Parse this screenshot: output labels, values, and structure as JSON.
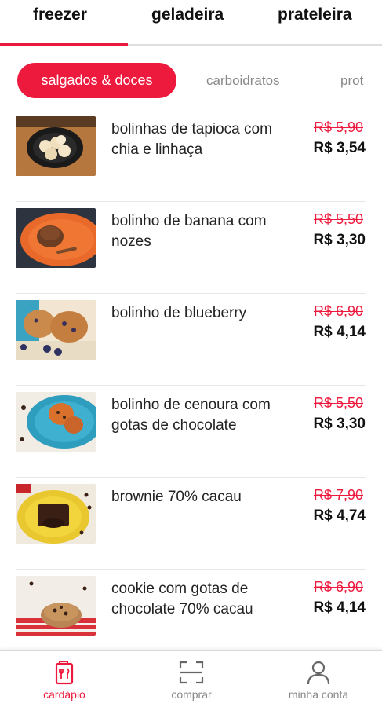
{
  "top_tabs": [
    {
      "label": "freezer",
      "active": true
    },
    {
      "label": "geladeira",
      "active": false
    },
    {
      "label": "prateleira",
      "active": false
    }
  ],
  "sub_tabs": [
    {
      "label": "salgados & doces",
      "active": true
    },
    {
      "label": "carboidratos",
      "active": false
    },
    {
      "label": "prot",
      "active": false
    }
  ],
  "products": [
    {
      "name": "bolinhas de tapioca com chia e linhaça",
      "old_price": "R$ 5,90",
      "price": "R$ 3,54"
    },
    {
      "name": "bolinho de banana com nozes",
      "old_price": "R$ 5,50",
      "price": "R$ 3,30"
    },
    {
      "name": "bolinho de blueberry",
      "old_price": "R$ 6,90",
      "price": "R$ 4,14"
    },
    {
      "name": "bolinho de cenoura com gotas de chocolate",
      "old_price": "R$ 5,50",
      "price": "R$ 3,30"
    },
    {
      "name": "brownie 70% cacau",
      "old_price": "R$ 7,90",
      "price": "R$ 4,74"
    },
    {
      "name": "cookie com gotas de chocolate 70% cacau",
      "old_price": "R$ 6,90",
      "price": "R$ 4,14"
    }
  ],
  "bottom_nav": [
    {
      "label": "cardápio",
      "icon": "menu-card-icon",
      "active": true
    },
    {
      "label": "comprar",
      "icon": "scan-icon",
      "active": false
    },
    {
      "label": "minha conta",
      "icon": "user-icon",
      "active": false
    }
  ],
  "colors": {
    "accent": "#ee1a3d",
    "text": "#222222",
    "muted": "#888888"
  }
}
